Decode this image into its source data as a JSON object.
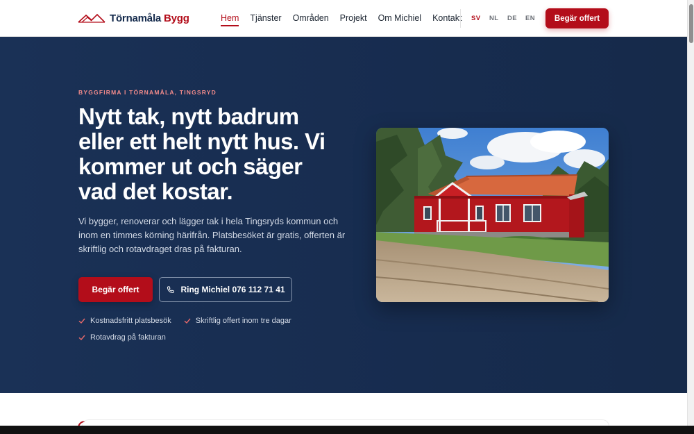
{
  "brand": {
    "name_part1": "Törnamåla",
    "name_part2": "Bygg",
    "primary_color": "#b30d1a",
    "navy_color": "#13294b"
  },
  "nav": {
    "items": [
      {
        "label": "Hem",
        "active": true
      },
      {
        "label": "Tjänster",
        "active": false
      },
      {
        "label": "Områden",
        "active": false
      },
      {
        "label": "Projekt",
        "active": false
      },
      {
        "label": "Om Michiel",
        "active": false
      },
      {
        "label": "Kontakt",
        "active": false
      }
    ],
    "languages": [
      {
        "code": "SV",
        "active": true
      },
      {
        "code": "NL",
        "active": false
      },
      {
        "code": "DE",
        "active": false
      },
      {
        "code": "EN",
        "active": false
      }
    ],
    "cta_label": "Begär offert"
  },
  "hero": {
    "eyebrow": "BYGGFIRMA I TÖRNAMÅLA, TINGSRYD",
    "headline": "Nytt tak, nytt badrum eller ett helt nytt hus. Vi kommer ut och säger vad det kostar.",
    "lead": "Vi bygger, renoverar och lägger tak i hela Tingsryds kommun och inom en timmes körning härifrån. Platsbesöket är gratis, offerten är skriftlig och rotavdraget dras på fakturan.",
    "primary_button": "Begär offert",
    "phone_button": "Ring Michiel 076 112 71 41",
    "checks": [
      "Kostnadsfritt platsbesök",
      "Skriftlig offert inom tre dagar",
      "Rotavdrag på fakturan"
    ],
    "photo_icon": "red-house-photo"
  }
}
